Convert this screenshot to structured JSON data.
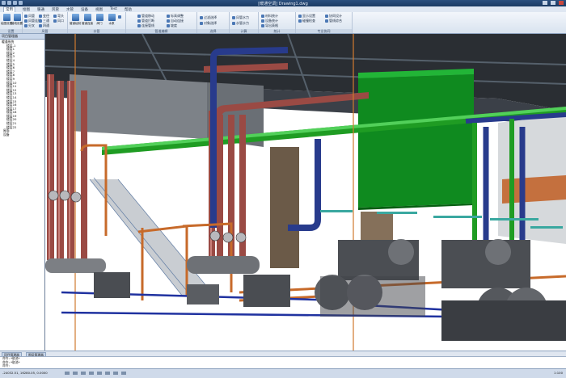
{
  "window": {
    "title": "[暖通空调] Drawing1.dwg"
  },
  "tabs": [
    "常用",
    "绘图",
    "暖通",
    "风管",
    "水管",
    "设备",
    "视图",
    "Test",
    "帮助"
  ],
  "ribbon": {
    "groups": [
      {
        "caption": "设置",
        "buttons": [
          "绘图设置",
          "管线设置",
          "图层管理"
        ]
      },
      {
        "caption": "风管",
        "buttons": [
          "风管",
          "风管连接",
          "分叉",
          "变径",
          "三通",
          "四通",
          "弯头",
          "风口"
        ]
      },
      {
        "caption": "水管",
        "buttons": [
          "管道绘制",
          "管道连接",
          "阀门",
          "水泵",
          "接入设备"
        ]
      },
      {
        "caption": "管道编辑",
        "buttons": [
          "管道移动",
          "管道打断",
          "连接管线",
          "标高调整",
          "自动连接",
          "坡度"
        ]
      },
      {
        "caption": "选择",
        "buttons": [
          "过滤选择",
          "对象选择"
        ]
      },
      {
        "caption": "计算",
        "buttons": [
          "风管水力",
          "水管水力"
        ]
      },
      {
        "caption": "统计",
        "buttons": [
          "材料统计",
          "设备统计",
          "导出表格"
        ]
      },
      {
        "caption": "专业协同",
        "buttons": [
          "显示设置",
          "碰撞检查",
          "协同设计",
          "管线综合"
        ]
      }
    ]
  },
  "project_panel": {
    "header": "项目管理器",
    "root": "暖通系统",
    "items": [
      "楼层-1",
      "楼层1",
      "楼层2",
      "楼层3",
      "楼层4",
      "楼层5",
      "楼层6",
      "楼层7",
      "楼层8",
      "楼层9",
      "楼层10",
      "楼层11",
      "楼层12",
      "楼层13",
      "楼层14",
      "楼层15",
      "楼层16",
      "楼层17",
      "楼层18",
      "楼层19",
      "楼层20",
      "楼层21",
      "楼层22"
    ],
    "extra": [
      "屋面",
      "设备"
    ]
  },
  "bottom_tabs": [
    "项目管理器",
    "图层管理器"
  ],
  "command_lines": [
    "命令: *取消*",
    "命令: *取消*",
    "命令:"
  ],
  "status": {
    "coords": "-24032.51, 16280.05, 0.0000",
    "zoom": "1:100"
  },
  "colors": {
    "chilled_water": "#1a7f1a",
    "supply_pipe": "#9a4a44",
    "return_pipe": "#283b8c",
    "duct": "#1f8f1f",
    "copper": "#c76a2a"
  }
}
